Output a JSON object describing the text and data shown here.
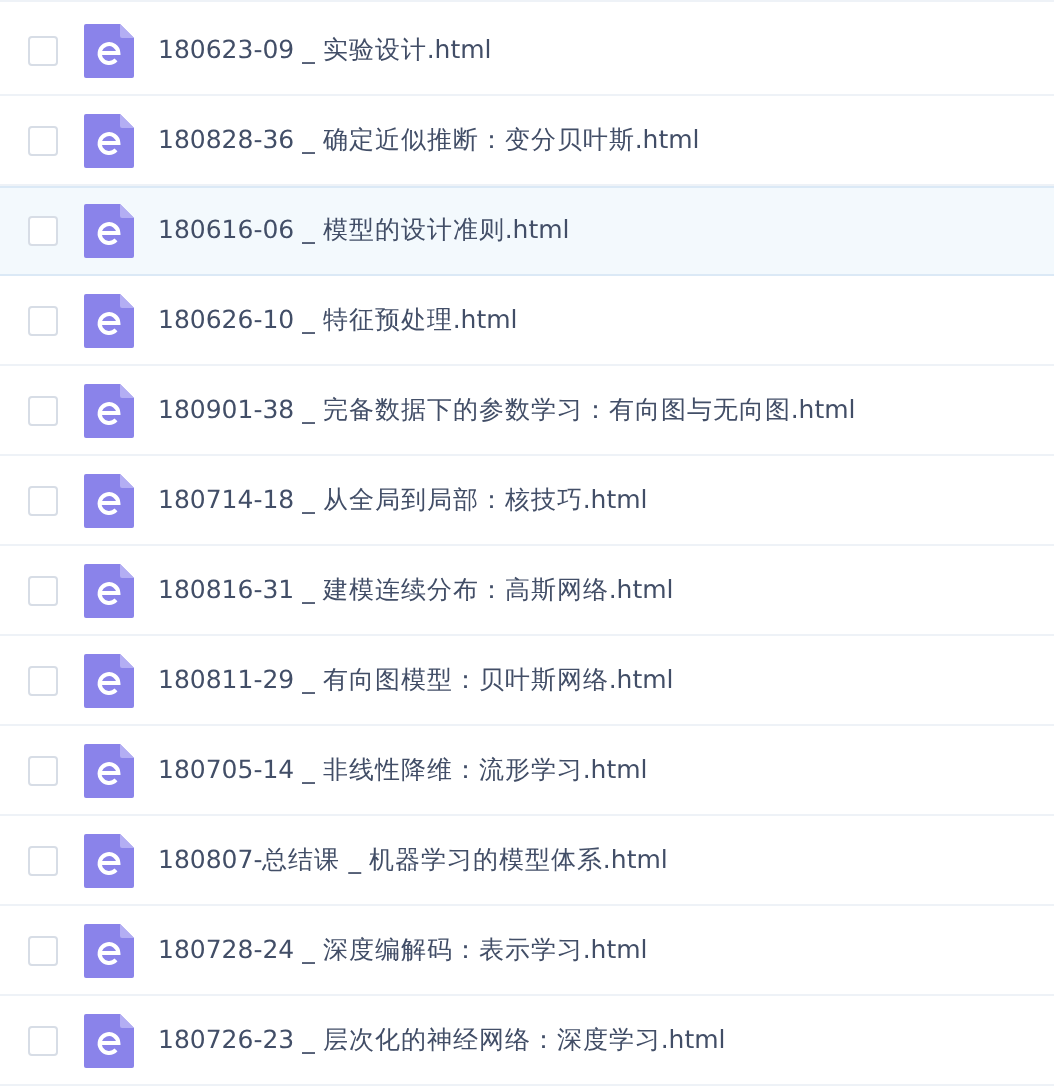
{
  "files": [
    {
      "name": "180623-09 _ 实验设计.html",
      "checked": false,
      "highlighted": false
    },
    {
      "name": "180828-36 _ 确定近似推断：变分贝叶斯.html",
      "checked": false,
      "highlighted": false
    },
    {
      "name": "180616-06 _ 模型的设计准则.html",
      "checked": false,
      "highlighted": true
    },
    {
      "name": "180626-10 _ 特征预处理.html",
      "checked": false,
      "highlighted": false
    },
    {
      "name": "180901-38 _ 完备数据下的参数学习：有向图与无向图.html",
      "checked": false,
      "highlighted": false
    },
    {
      "name": "180714-18 _ 从全局到局部：核技巧.html",
      "checked": false,
      "highlighted": false
    },
    {
      "name": "180816-31 _ 建模连续分布：高斯网络.html",
      "checked": false,
      "highlighted": false
    },
    {
      "name": "180811-29 _ 有向图模型：贝叶斯网络.html",
      "checked": false,
      "highlighted": false
    },
    {
      "name": "180705-14 _ 非线性降维：流形学习.html",
      "checked": false,
      "highlighted": false
    },
    {
      "name": "180807-总结课 _ 机器学习的模型体系.html",
      "checked": false,
      "highlighted": false
    },
    {
      "name": "180728-24 _ 深度编解码：表示学习.html",
      "checked": false,
      "highlighted": false
    },
    {
      "name": "180726-23 _ 层次化的神经网络：深度学习.html",
      "checked": false,
      "highlighted": false
    }
  ]
}
